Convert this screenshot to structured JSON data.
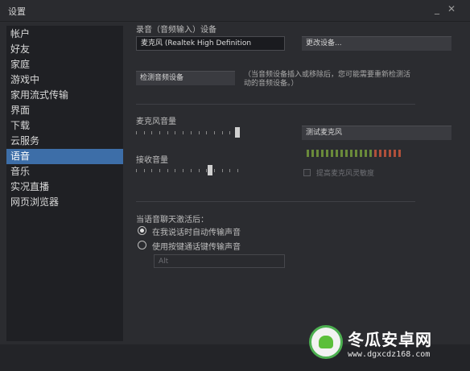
{
  "window": {
    "title": "设置",
    "close_glyph": "✕",
    "minimize_glyph": "_"
  },
  "sidebar": {
    "items": [
      {
        "label": "帐户"
      },
      {
        "label": "好友"
      },
      {
        "label": "家庭"
      },
      {
        "label": "游戏中"
      },
      {
        "label": "家用流式传输"
      },
      {
        "label": "界面"
      },
      {
        "label": "下载"
      },
      {
        "label": "云服务"
      },
      {
        "label": "语音",
        "selected": true
      },
      {
        "label": "音乐"
      },
      {
        "label": "实况直播"
      },
      {
        "label": "网页浏览器"
      }
    ]
  },
  "voice": {
    "recording_device_label": "录音（音频输入）设备",
    "device_value": "麦克风 (Realtek High Definition",
    "change_device_button": "更改设备...",
    "detect_button": "检测音频设备",
    "detect_hint_line1": "（当音频设备插入或移除后，您可能需要重新检测活",
    "detect_hint_line2": "动的音频设备。）",
    "mic_volume_label": "麦克风音量",
    "mic_volume_level": 1.0,
    "test_mic_button": "测试麦克风",
    "receive_volume_label": "接收音量",
    "receive_volume_level": 0.73,
    "boost_mic_label": "提高麦克风灵敏度",
    "boost_mic_checked": false,
    "activation_label": "当语音聊天激活后：",
    "auto_transmit_label": "在我说话时自动传输声音",
    "ptt_label": "使用按键通话键传输声音",
    "selected_mode": "auto",
    "ptt_key_value": "Alt",
    "meter_colors": {
      "green": "#6a8a3a",
      "red": "#b0503a"
    }
  },
  "watermark": {
    "title": "冬瓜安卓网",
    "url": "www.dgxcdz168.com"
  }
}
